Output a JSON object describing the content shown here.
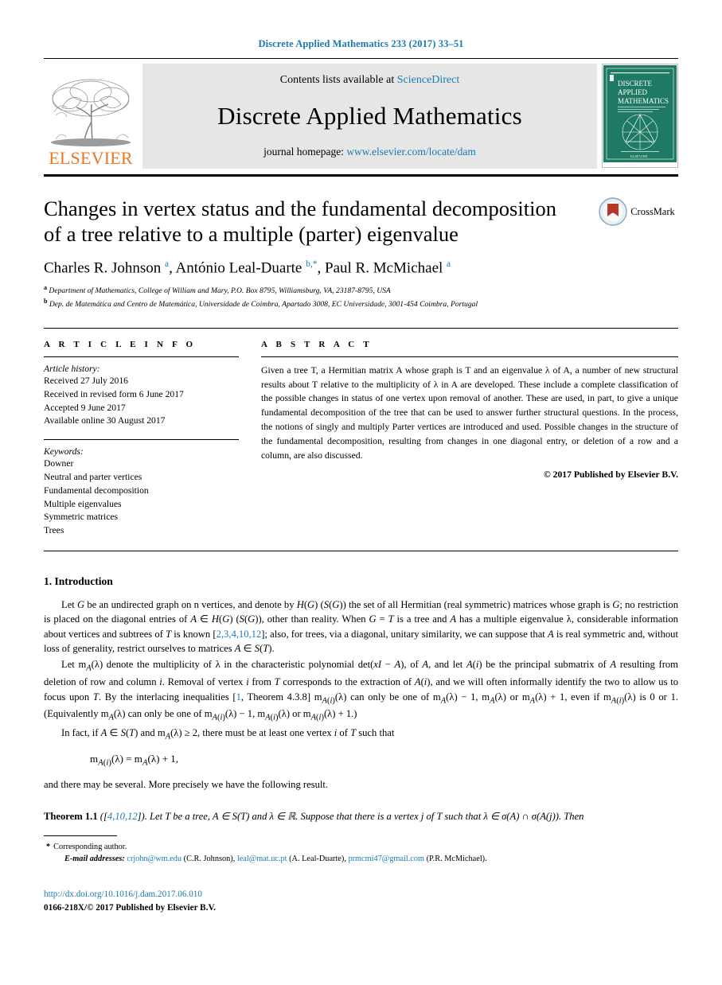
{
  "running_head": "Discrete Applied Mathematics 233 (2017) 33–51",
  "banner": {
    "publisher_logo_text": "ELSEVIER",
    "contents_prefix": "Contents lists available at ",
    "contents_link": "ScienceDirect",
    "journal_title": "Discrete Applied Mathematics",
    "homepage_prefix": "journal homepage: ",
    "homepage_url": "www.elsevier.com/locate/dam",
    "cover_lines": [
      "DISCRETE",
      "APPLIED",
      "MATHEMATICS"
    ]
  },
  "crossmark": {
    "label": "CrossMark"
  },
  "article": {
    "title_line1": "Changes in vertex status and the fundamental decomposition",
    "title_line2": "of a tree relative to a multiple (parter) eigenvalue",
    "authors_html": "Charles R. Johnson <sup>a</sup>, António Leal-Duarte <sup>b,*</sup>, Paul R. McMichael <sup>a</sup>",
    "affiliation_a": "Department of Mathematics, College of William and Mary, P.O. Box 8795, Williamsburg, VA, 23187-8795, USA",
    "affiliation_b": "Dep. de Matemática and Centro de Matemática, Universidade de Coimbra, Apartado 3008, EC Universidade, 3001-454 Coimbra, Portugal"
  },
  "info": {
    "heading": "A R T I C L E   I N F O",
    "history_title": "Article history:",
    "history": [
      "Received 27 July 2016",
      "Received in revised form 6 June 2017",
      "Accepted 9 June 2017",
      "Available online 30 August 2017"
    ],
    "keywords_title": "Keywords:",
    "keywords": [
      "Downer",
      "Neutral and parter vertices",
      "Fundamental decomposition",
      "Multiple eigenvalues",
      "Symmetric matrices",
      "Trees"
    ]
  },
  "abstract": {
    "heading": "A B S T R A C T",
    "text": "Given a tree T, a Hermitian matrix A whose graph is T and an eigenvalue λ of A, a number of new structural results about T relative to the multiplicity of λ in A are developed. These include a complete classification of the possible changes in status of one vertex upon removal of another. These are used, in part, to give a unique fundamental decomposition of the tree that can be used to answer further structural questions. In the process, the notions of singly and multiply Parter vertices are introduced and used. Possible changes in the structure of the fundamental decomposition, resulting from changes in one diagonal entry, or deletion of a row and a column, are also discussed.",
    "copyright": "© 2017 Published by Elsevier B.V."
  },
  "section": {
    "number_title": "1.  Introduction",
    "para1": "Let G be an undirected  graph on n vertices, and denote by H(G) (S(G)) the set of all Hermitian (real symmetric) matrices whose graph is G; no restriction is placed on the diagonal entries of A ∈ H(G) (S(G)), other than reality. When G = T is a tree and A has a multiple eigenvalue λ, considerable information about vertices and subtrees of T  is known [2,3,4,10,12]; also, for trees, via a diagonal, unitary similarity, we can suppose that A is real symmetric and, without loss of generality, restrict ourselves to matrices A ∈ S(T).",
    "para1_refs": "2,3,4,10,12",
    "para2": "Let mA(λ) denote the multiplicity of λ in the characteristic polynomial det(xI − A), of A, and let A(i) be the principal submatrix of A resulting from deletion of row and column i. Removal of vertex i from T corresponds to the extraction of A(i), and we will often informally identify the two to allow us to focus upon T. By the interlacing inequalities [1, Theorem 4.3.8] mA(i)(λ) can only be one of mA(λ) − 1, mA(λ) or mA(λ) + 1, even if mA(i)(λ) is 0 or 1. (Equivalently mA(λ) can only be one of mA(i)(λ) − 1, mA(i)(λ) or mA(i)(λ) + 1.)",
    "para2_ref": "1",
    "para3": "In fact, if A ∈ S(T) and mA(λ) ≥ 2, there must be at least one vertex i of T such that",
    "equation": "mA(i)(λ) = mA(λ) + 1,",
    "para4": "and there may be several. More precisely we have the following result.",
    "theorem_name": "Theorem 1.1",
    "theorem_refs": "4,10,12",
    "theorem_body": "Let T be a tree, A ∈ S(T) and λ ∈ ℝ. Suppose that there is a vertex j of T such that λ ∈ σ(A) ∩ σ(A(j)). Then"
  },
  "footnotes": {
    "corresponding": "Corresponding author.",
    "email_label": "E-mail addresses:",
    "emails": [
      {
        "address": "crjohn@wm.edu",
        "owner": "(C.R. Johnson)"
      },
      {
        "address": "leal@mat.uc.pt",
        "owner": "(A. Leal-Duarte)"
      },
      {
        "address": "prmcmi47@gmail.com",
        "owner": "(P.R. McMichael)"
      }
    ],
    "doi": "http://dx.doi.org/10.1016/j.dam.2017.06.010",
    "issn_line": "0166-218X/© 2017 Published by Elsevier B.V."
  },
  "colors": {
    "link": "#1a7bb0",
    "elsevier_orange": "#E87722",
    "cover_green": "#1f7a63",
    "crossmark_red": "#c0392b"
  }
}
